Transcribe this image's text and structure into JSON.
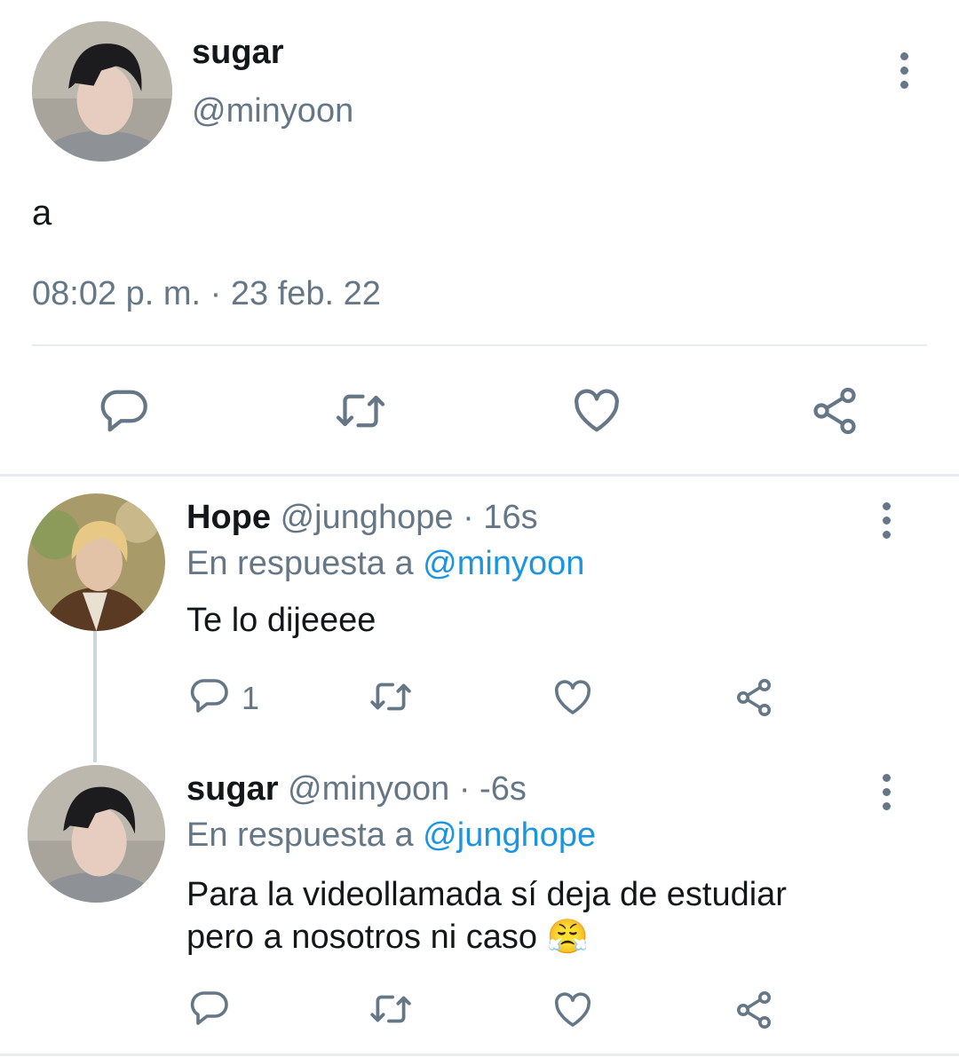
{
  "main_tweet": {
    "display_name": "sugar",
    "handle": "@minyoon",
    "text": "a",
    "timestamp": "08:02 p. m. · 23 feb. 22",
    "actions": [
      "reply-icon",
      "retweet-icon",
      "like-icon",
      "share-icon"
    ]
  },
  "replies": [
    {
      "display_name": "Hope",
      "handle": "@junghope",
      "time": "· 16s",
      "reply_prefix": "En respuesta a",
      "reply_to": "@minyoon",
      "text_line1": "Te lo dijeeee",
      "reply_count": "1"
    },
    {
      "display_name": "sugar",
      "handle": "@minyoon",
      "time": "· -6s",
      "reply_prefix": "En respuesta a",
      "reply_to": "@junghope",
      "text_line1": "Para la videollamada sí deja de estudiar",
      "text_line2": "pero a nosotros ni caso",
      "emoji": "😤"
    }
  ],
  "colors": {
    "text": "#14171a",
    "secondary": "#657786",
    "link": "#1b95e0",
    "divider": "#e6ecf0"
  }
}
